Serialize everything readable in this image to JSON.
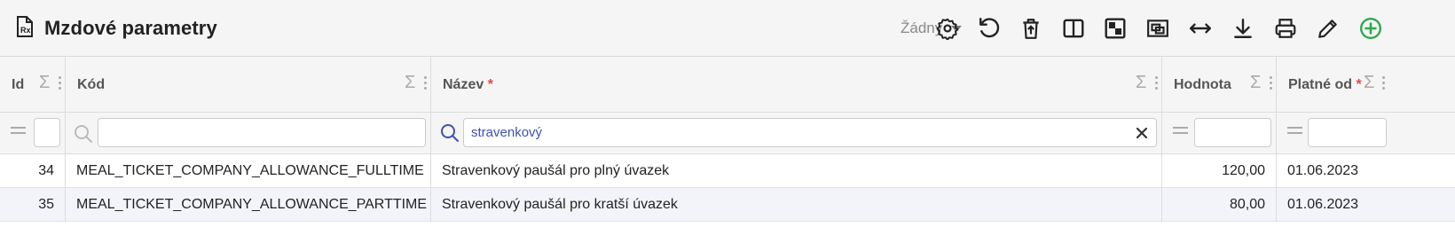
{
  "header": {
    "title": "Mzdové parametry",
    "icon": "document-receipt-icon",
    "variant_label": "Žádný"
  },
  "toolbar": {
    "buttons": [
      "settings-icon",
      "refresh-icon",
      "delete-icon",
      "split-view-icon",
      "layout-icon",
      "zoom-fit-icon",
      "expand-width-icon",
      "download-icon",
      "print-icon",
      "edit-icon",
      "add-icon"
    ],
    "accent_color": "#2fa84f"
  },
  "columns": [
    {
      "label": "Id",
      "required": false
    },
    {
      "label": "Kód",
      "required": false
    },
    {
      "label": "Název",
      "required": true,
      "required_mark": "*"
    },
    {
      "label": "Hodnota",
      "required": false
    },
    {
      "label": "Platné od",
      "required": true,
      "required_mark": "*"
    }
  ],
  "filters": {
    "id": "",
    "kod": "",
    "nazev": "stravenkový",
    "hodnota": "",
    "platne_od": ""
  },
  "rows": [
    {
      "id": "34",
      "kod": "MEAL_TICKET_COMPANY_ALLOWANCE_FULLTIME",
      "nazev": "Stravenkový paušál pro plný úvazek",
      "hodnota": "120,00",
      "platne_od": "01.06.2023"
    },
    {
      "id": "35",
      "kod": "MEAL_TICKET_COMPANY_ALLOWANCE_PARTTIME",
      "nazev": "Stravenkový paušál pro kratší úvazek",
      "hodnota": "80,00",
      "platne_od": "01.06.2023"
    }
  ]
}
